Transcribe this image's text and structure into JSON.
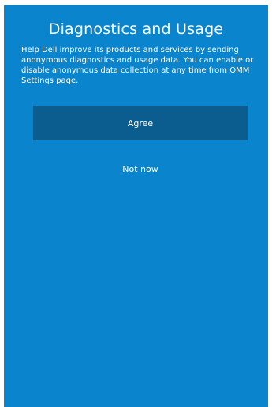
{
  "dialog": {
    "title": "Diagnostics and Usage",
    "description": "Help Dell improve its products and services by sending anonymous diagnostics and usage data. You can enable or disable anonymous data collection at any time from OMM Settings page.",
    "agree_label": "Agree",
    "not_now_label": "Not now"
  },
  "colors": {
    "background": "#0a84cc",
    "button": "#0b5d8f",
    "text": "#ffffff"
  }
}
